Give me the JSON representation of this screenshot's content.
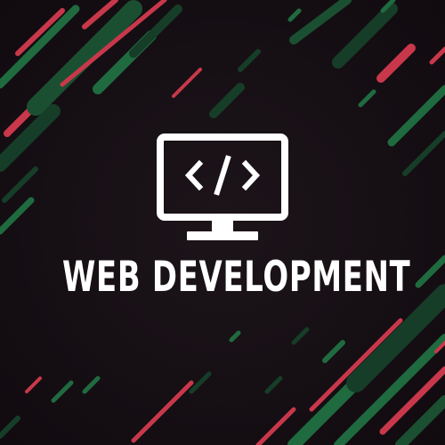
{
  "title": "WEB DEVELOPMENT",
  "icons": {
    "monitor": "monitor-code-icon",
    "code": "code-brackets-icon"
  },
  "colors": {
    "background": "#150f14",
    "accent_red": "#c8384a",
    "accent_green": "#1f6b3f",
    "accent_dark_green": "#163d28",
    "foreground": "#ffffff"
  }
}
